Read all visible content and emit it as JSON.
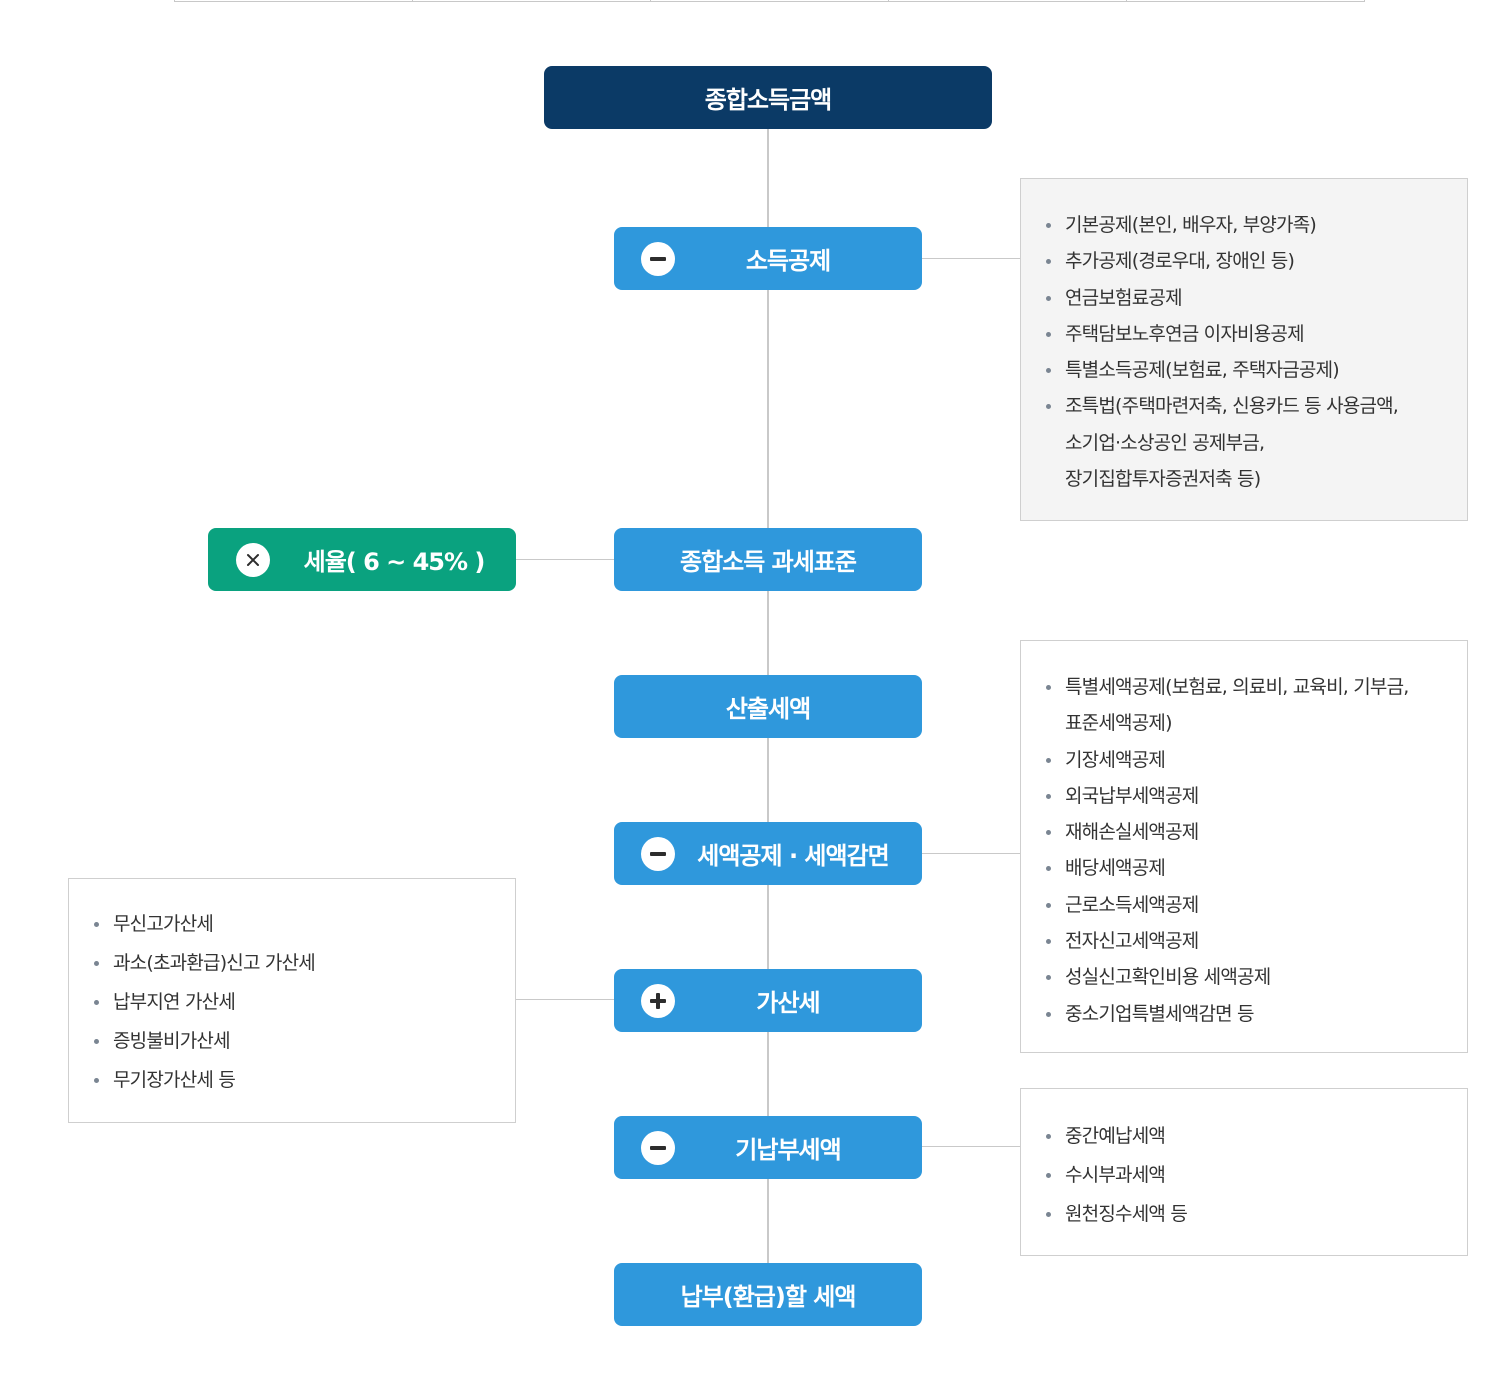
{
  "flow": {
    "total_income": "종합소득금액",
    "income_deduction": "소득공제",
    "tax_base": "종합소득 과세표준",
    "calculated_tax": "산출세액",
    "tax_credit": "세액공제 · 세액감면",
    "additional_tax": "가산세",
    "prepaid_tax": "기납부세액",
    "payable_tax": "납부(환급)할 세액",
    "tax_rate": "세율( 6 ~ 45% )"
  },
  "icons": {
    "income_deduction": "minus-icon",
    "tax_credit": "minus-icon",
    "additional_tax": "plus-icon",
    "prepaid_tax": "minus-icon",
    "tax_rate": "multiply-icon"
  },
  "colors": {
    "dark_node": "#0b3a66",
    "blue_node": "#2f98dc",
    "green_node": "#0aa27f"
  },
  "income_deduction_items": [
    "기본공제(본인, 배우자, 부양가족)",
    "추가공제(경로우대, 장애인 등)",
    "연금보험료공제",
    "주택담보노후연금 이자비용공제",
    "특별소득공제(보험료, 주택자금공제)",
    "조특법(주택마련저축, 신용카드 등 사용금액,",
    "소기업·소상공인 공제부금,",
    "장기집합투자증권저축 등)"
  ],
  "tax_credit_items": [
    "특별세액공제(보험료, 의료비, 교육비, 기부금,",
    "표준세액공제)",
    "기장세액공제",
    "외국납부세액공제",
    "재해손실세액공제",
    "배당세액공제",
    "근로소득세액공제",
    "전자신고세액공제",
    "성실신고확인비용 세액공제",
    "중소기업특별세액감면 등"
  ],
  "additional_tax_items": [
    "무신고가산세",
    "과소(초과환급)신고 가산세",
    "납부지연 가산세",
    "증빙불비가산세",
    "무기장가산세 등"
  ],
  "prepaid_tax_items": [
    "중간예납세액",
    "수시부과세액",
    "원천징수세액 등"
  ]
}
